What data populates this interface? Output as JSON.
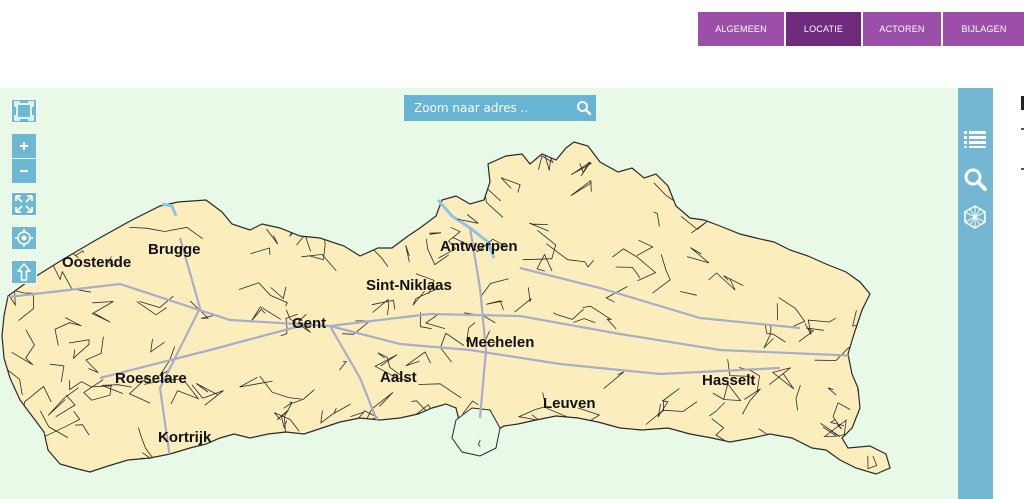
{
  "tabs": [
    {
      "label": "ALGEMEEN",
      "active": false
    },
    {
      "label": "LOCATIE",
      "active": true
    },
    {
      "label": "ACTOREN",
      "active": false
    },
    {
      "label": "BIJLAGEN",
      "active": false
    }
  ],
  "colors": {
    "tab": "#9c4fa8",
    "tab_active": "#6e2a7c",
    "map_bg": "#e8f9e8",
    "land_fill": "#fcedbd",
    "border": "#2a2a2a",
    "road": "#a9aec8",
    "water": "#8ec5e6",
    "panel": "#73b7d3"
  },
  "search": {
    "placeholder": "Zoom naar adres ..",
    "icon": "search-icon"
  },
  "map_controls": [
    {
      "name": "fullscreen-icon"
    },
    {
      "name": "zoom-in-icon"
    },
    {
      "name": "zoom-out-icon"
    },
    {
      "name": "zoom-to-extent-icon"
    },
    {
      "name": "locate-me-icon"
    },
    {
      "name": "north-arrow-icon"
    }
  ],
  "side_panel": [
    {
      "name": "layers-list-icon"
    },
    {
      "name": "search-panel-icon"
    },
    {
      "name": "draw-polygon-icon"
    }
  ],
  "cities": [
    "Oostende",
    "Brugge",
    "Antwerpen",
    "Sint-Niklaas",
    "Gent",
    "Mechelen",
    "Roeselare",
    "Aalst",
    "Hasselt",
    "Leuven",
    "Kortrijk"
  ]
}
